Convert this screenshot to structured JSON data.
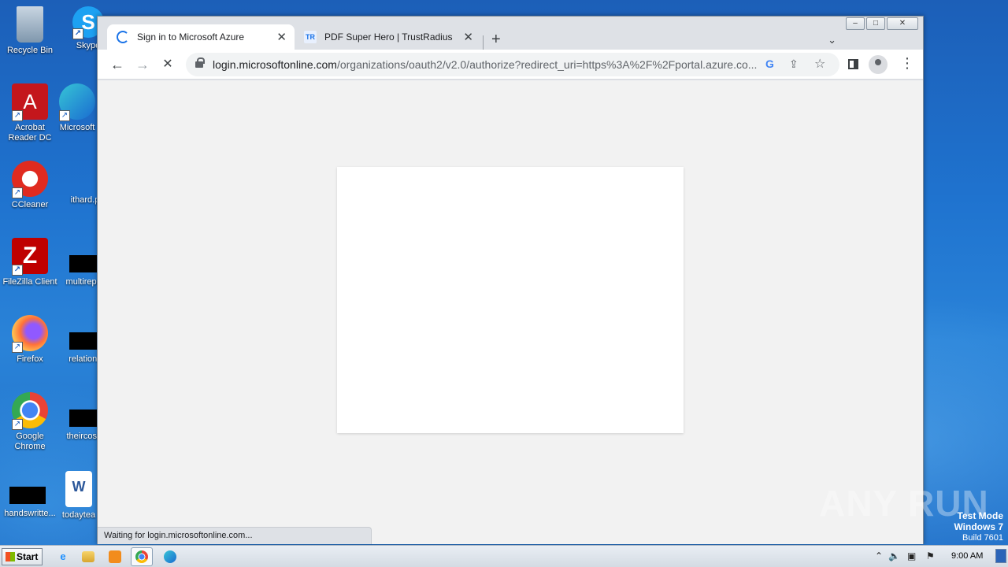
{
  "desktop": {
    "icons": [
      {
        "label": "Recycle Bin"
      },
      {
        "label": "Skype"
      },
      {
        "label": "Acrobat Reader DC"
      },
      {
        "label": "Microsoft"
      },
      {
        "label": "CCleaner"
      },
      {
        "label": "ithard.p"
      },
      {
        "label": "FileZilla Client"
      },
      {
        "label": "multirepor"
      },
      {
        "label": "Firefox"
      },
      {
        "label": "relations"
      },
      {
        "label": "Google Chrome"
      },
      {
        "label": "theircosts"
      },
      {
        "label": "handswritte..."
      },
      {
        "label": "todaytea"
      }
    ]
  },
  "browser": {
    "tabs": [
      {
        "title": "Sign in to Microsoft Azure",
        "active": true
      },
      {
        "title": "PDF Super Hero | TrustRadius",
        "active": false
      }
    ],
    "new_tab": "+",
    "tab_close": "✕",
    "tablist_icon": "⌄",
    "nav": {
      "back": "←",
      "forward": "→",
      "stop": "✕"
    },
    "url_host": "login.microsoftonline.com",
    "url_path": "/organizations/oauth2/v2.0/authorize?redirect_uri=https%3A%2F%2Fportal.azure.co...",
    "google_icon": "G",
    "share_icon": "⇪",
    "bookmark_icon": "☆",
    "menu_icon": "⋮",
    "status_text": "Waiting for login.microsoftonline.com..."
  },
  "window_controls": {
    "minimize": "‒",
    "maximize": "□",
    "close": "✕"
  },
  "watermark": {
    "text": "ANY RUN"
  },
  "test_mode": {
    "line1": "Test Mode",
    "line2": "Windows 7",
    "line3": "Build 7601"
  },
  "taskbar": {
    "start_label": "Start",
    "tray_up": "⌃",
    "clock": "9:00 AM"
  }
}
